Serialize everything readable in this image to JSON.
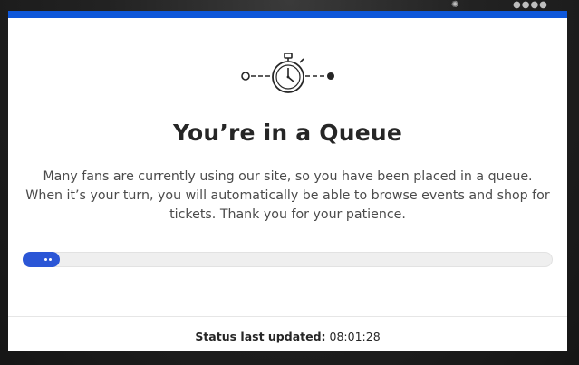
{
  "queue": {
    "title": "You’re in a Queue",
    "message": "Many fans are currently using our site, so you have been placed in a queue. When it’s your turn, you will automatically be able to browse events and shop for tickets. Thank you for your patience.",
    "progress_percent": 7
  },
  "status": {
    "label": "Status last updated:",
    "time": "08:01:28"
  },
  "icons": {
    "timeline": "stopwatch-timeline-icon"
  },
  "colors": {
    "accent": "#0e57d9",
    "progress": "#2b56d6",
    "title": "#262626"
  }
}
